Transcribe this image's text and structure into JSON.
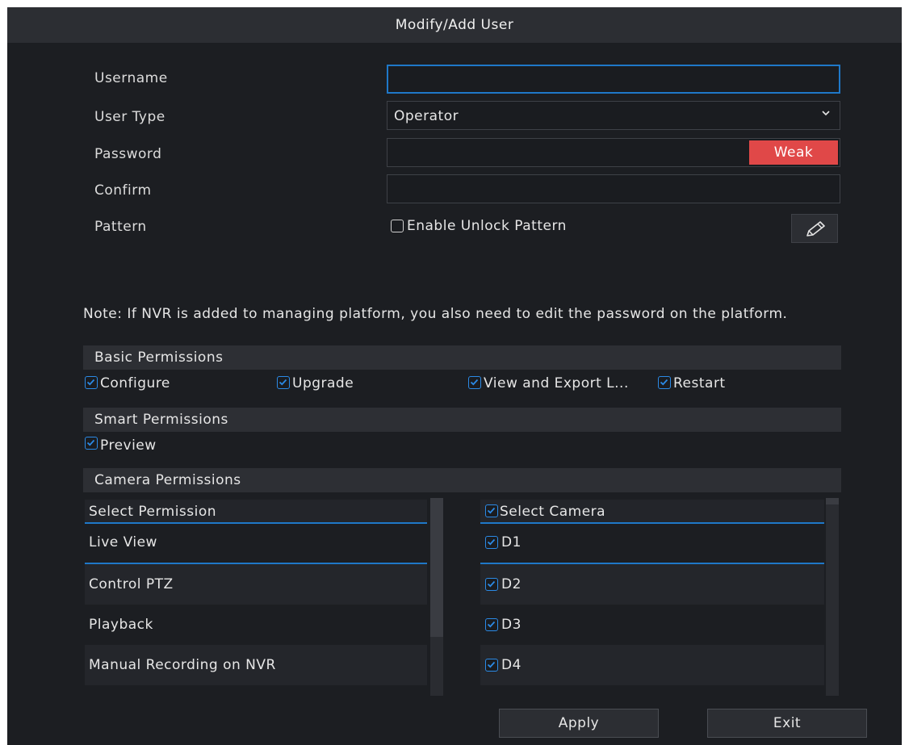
{
  "dialog": {
    "title": "Modify/Add User"
  },
  "form": {
    "username_label": "Username",
    "username_value": "",
    "user_type_label": "User Type",
    "user_type_value": "Operator",
    "password_label": "Password",
    "password_strength": "Weak",
    "confirm_label": "Confirm",
    "pattern_label": "Pattern",
    "enable_pattern_label": "Enable Unlock Pattern",
    "enable_pattern_checked": false
  },
  "note": "Note: If NVR is added to managing platform, you also need to edit the password on the platform.",
  "basic_permissions": {
    "title": "Basic Permissions",
    "items": [
      {
        "label": "Configure",
        "checked": true
      },
      {
        "label": "Upgrade",
        "checked": true
      },
      {
        "label": "View and Export L...",
        "checked": true
      },
      {
        "label": "Restart",
        "checked": true
      }
    ]
  },
  "smart_permissions": {
    "title": "Smart Permissions",
    "items": [
      {
        "label": "Preview",
        "checked": true
      }
    ]
  },
  "camera_permissions": {
    "title": "Camera Permissions",
    "permission_header": "Select Permission",
    "permissions": [
      "Live View",
      "Control PTZ",
      "Playback",
      "Manual Recording on NVR"
    ],
    "camera_header": "Select Camera",
    "cameras": [
      "D1",
      "D2",
      "D3",
      "D4"
    ]
  },
  "buttons": {
    "apply": "Apply",
    "exit": "Exit"
  },
  "colors": {
    "accent": "#1f78c8",
    "weak": "#e04848",
    "background": "#1c1e22",
    "titlebar": "#2c2e33"
  },
  "icons": {
    "dropdown": "chevron-down-icon",
    "edit": "pencil-icon",
    "check": "checkbox-checked-icon"
  }
}
